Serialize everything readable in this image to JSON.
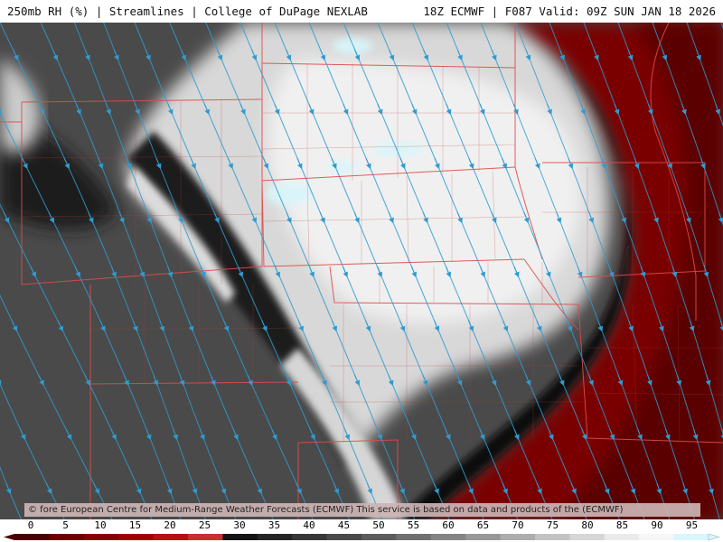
{
  "header": {
    "left_title": "250mb RH (%) | Streamlines | College of DuPage NEXLAB",
    "right_title": "18Z ECMWF | F087 Valid: 09Z SUN JAN 18 2026"
  },
  "credit": {
    "text": "© fore European Centre for Medium-Range Weather Forecasts (ECMWF)  This service is based on data and products of the (ECMWF)"
  },
  "colors": {
    "border_lines": "#e04a4a",
    "streamlines": "#2f9bd0",
    "dry_red": "#7a0000",
    "background_grey": "#4a4a4a"
  },
  "legend": {
    "unit": "%",
    "labels": [
      "0",
      "5",
      "10",
      "15",
      "20",
      "25",
      "30",
      "35",
      "40",
      "45",
      "50",
      "55",
      "60",
      "65",
      "70",
      "75",
      "80",
      "85",
      "90",
      "95"
    ],
    "colors": [
      "#4a0000",
      "#6a0000",
      "#850000",
      "#a00000",
      "#b81010",
      "#c83030",
      "#141414",
      "#262626",
      "#383838",
      "#4a4a4a",
      "#5d5d5d",
      "#707070",
      "#848484",
      "#989898",
      "#adadad",
      "#c2c2c2",
      "#d6d6d6",
      "#eaeaea",
      "#f6f6f6",
      "#d8f6fb"
    ]
  }
}
